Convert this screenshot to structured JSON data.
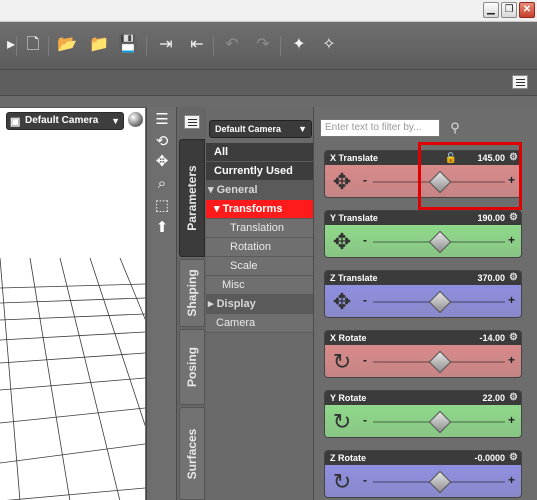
{
  "window": {
    "minimize_icon": "minimize-icon",
    "restore_icon": "restore-icon",
    "close_icon": "close-icon"
  },
  "toolbar": {
    "icons": [
      "new-file-icon",
      "open-icon",
      "open-folder-icon",
      "save-icon",
      "import-icon",
      "export-icon",
      "undo-icon",
      "redo-icon",
      "figure-icon",
      "scene-icon"
    ]
  },
  "viewport": {
    "camera_label": "Default Camera",
    "tools": [
      "menu-icon",
      "orbit-icon",
      "pan-icon",
      "zoom-icon",
      "frame-icon",
      "up-icon"
    ]
  },
  "side_tabs": [
    "Parameters",
    "Shaping",
    "Posing",
    "Surfaces"
  ],
  "tree": {
    "node_selector": "Default Camera",
    "items": [
      {
        "label": "All",
        "kind": "hdr"
      },
      {
        "label": "Currently Used",
        "kind": "hdr"
      },
      {
        "label": "▾ General",
        "kind": "grp"
      },
      {
        "label": "▾ Transforms",
        "kind": "sel"
      },
      {
        "label": "Translation",
        "kind": "sub"
      },
      {
        "label": "Rotation",
        "kind": "sub"
      },
      {
        "label": "Scale",
        "kind": "sub"
      },
      {
        "label": "Misc",
        "kind": "sub"
      },
      {
        "label": "▸ Display",
        "kind": "grp"
      },
      {
        "label": "Camera",
        "kind": "sub"
      }
    ]
  },
  "filter": {
    "placeholder": "Enter text to filter by..."
  },
  "params": [
    {
      "name": "X Translate",
      "value": "145.00",
      "color": "#d98a8a",
      "icon": "move-icon",
      "slider": 0.5,
      "locked": true
    },
    {
      "name": "Y Translate",
      "value": "190.00",
      "color": "#8fd98a",
      "icon": "move-icon",
      "slider": 0.5,
      "locked": false
    },
    {
      "name": "Z Translate",
      "value": "370.00",
      "color": "#8f8fe0",
      "icon": "move-icon",
      "slider": 0.5,
      "locked": false
    },
    {
      "name": "X Rotate",
      "value": "-14.00",
      "color": "#d98a8a",
      "icon": "rotate-icon",
      "slider": 0.5,
      "locked": false
    },
    {
      "name": "Y Rotate",
      "value": "22.00",
      "color": "#8fd98a",
      "icon": "rotate-icon",
      "slider": 0.5,
      "locked": false
    },
    {
      "name": "Z Rotate",
      "value": "-0.0000",
      "color": "#8f8fe0",
      "icon": "rotate-icon",
      "slider": 0.5,
      "locked": false
    }
  ]
}
